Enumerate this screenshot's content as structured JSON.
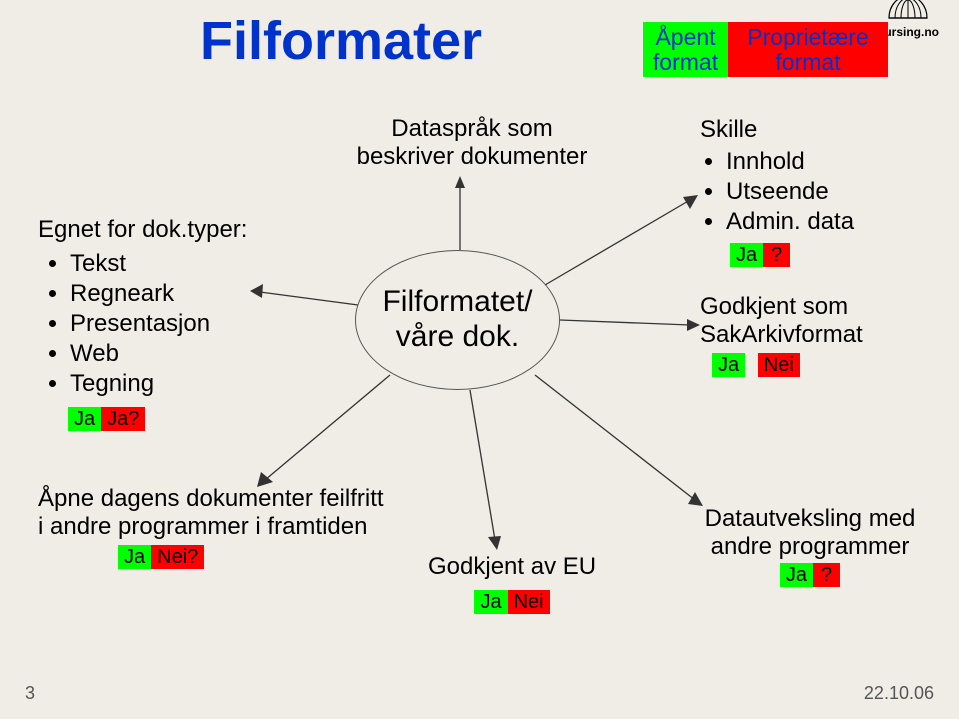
{
  "title": "Filformater",
  "header_tags": {
    "apent": "Åpent format",
    "proprietaere": "Proprietære format"
  },
  "logo": {
    "text": "kursing.no"
  },
  "center": {
    "label": "Filformatet/ våre dok."
  },
  "dataspraak": "Dataspråk som beskriver dokumenter",
  "egnet": {
    "heading": "Egnet for dok.typer:",
    "items": [
      "Tekst",
      "Regneark",
      "Presentasjon",
      "Web",
      "Tegning"
    ],
    "tag1": "Ja",
    "tag2": "Ja?"
  },
  "skille": {
    "heading": "Skille",
    "items": [
      "Innhold",
      "Utseende",
      "Admin. data"
    ],
    "tag_ja": "Ja",
    "tag_q": "?"
  },
  "godkjent_sak": {
    "line1": "Godkjent som",
    "line2": "SakArkivformat",
    "ja": "Ja",
    "nei": "Nei"
  },
  "apne_dagens": {
    "line1": "Åpne dagens dokumenter feilfritt",
    "line2": "i andre programmer i framtiden",
    "ja": "Ja",
    "nei": "Nei?"
  },
  "godkjent_eu": {
    "label": "Godkjent av EU",
    "ja": "Ja",
    "nei": "Nei"
  },
  "datautveksling": {
    "line1": "Datautveksling med",
    "line2": "andre programmer",
    "ja": "Ja",
    "q": "?"
  },
  "footer": {
    "page": "3",
    "date": "22.10.06"
  }
}
